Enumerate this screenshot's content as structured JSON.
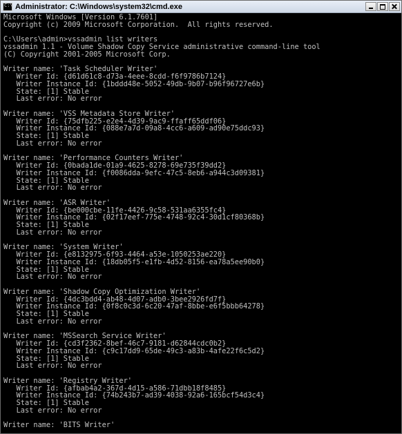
{
  "window": {
    "title": "Administrator: C:\\Windows\\system32\\cmd.exe"
  },
  "icons": {
    "app": "cmd-console-icon",
    "minimize": "minimize-icon",
    "maximize": "maximize-icon",
    "close": "close-icon"
  },
  "console": {
    "lines": [
      "Microsoft Windows [Version 6.1.7601]",
      "Copyright (c) 2009 Microsoft Corporation.  All rights reserved.",
      "",
      "C:\\Users\\admin>vssadmin list writers",
      "vssadmin 1.1 - Volume Shadow Copy Service administrative command-line tool",
      "(C) Copyright 2001-2005 Microsoft Corp.",
      "",
      "Writer name: 'Task Scheduler Writer'",
      "   Writer Id: {d61d61c8-d73a-4eee-8cdd-f6f9786b7124}",
      "   Writer Instance Id: {1bddd48e-5052-49db-9b07-b96f96727e6b}",
      "   State: [1] Stable",
      "   Last error: No error",
      "",
      "Writer name: 'VSS Metadata Store Writer'",
      "   Writer Id: {75dfb225-e2e4-4d39-9ac9-ffaff65ddf06}",
      "   Writer Instance Id: {088e7a7d-09a8-4cc6-a609-ad90e75ddc93}",
      "   State: [1] Stable",
      "   Last error: No error",
      "",
      "Writer name: 'Performance Counters Writer'",
      "   Writer Id: {0bada1de-01a9-4625-8278-69e735f39dd2}",
      "   Writer Instance Id: {f0086dda-9efc-47c5-8eb6-a944c3d09381}",
      "   State: [1] Stable",
      "   Last error: No error",
      "",
      "Writer name: 'ASR Writer'",
      "   Writer Id: {be000cbe-11fe-4426-9c58-531aa6355fc4}",
      "   Writer Instance Id: {02f17eef-775e-4748-92c4-30d1cf80368b}",
      "   State: [1] Stable",
      "   Last error: No error",
      "",
      "Writer name: 'System Writer'",
      "   Writer Id: {e8132975-6f93-4464-a53e-1050253ae220}",
      "   Writer Instance Id: {18db05f5-e1fb-4d52-8156-ea78a5ee90b0}",
      "   State: [1] Stable",
      "   Last error: No error",
      "",
      "Writer name: 'Shadow Copy Optimization Writer'",
      "   Writer Id: {4dc3bdd4-ab48-4d07-adb0-3bee2926fd7f}",
      "   Writer Instance Id: {0f8c0c3d-6c20-47af-8bbe-e6f5bbb64278}",
      "   State: [1] Stable",
      "   Last error: No error",
      "",
      "Writer name: 'MSSearch Service Writer'",
      "   Writer Id: {cd3f2362-8bef-46c7-9181-d62844cdc0b2}",
      "   Writer Instance Id: {c9c17dd9-65de-49c3-a83b-4afe22f6c5d2}",
      "   State: [1] Stable",
      "   Last error: No error",
      "",
      "Writer name: 'Registry Writer'",
      "   Writer Id: {afbab4a2-367d-4d15-a586-71dbb18f8485}",
      "   Writer Instance Id: {74b243b7-ad39-4038-92a6-165bcf54d3c4}",
      "   State: [1] Stable",
      "   Last error: No error",
      "",
      "Writer name: 'BITS Writer'"
    ]
  }
}
